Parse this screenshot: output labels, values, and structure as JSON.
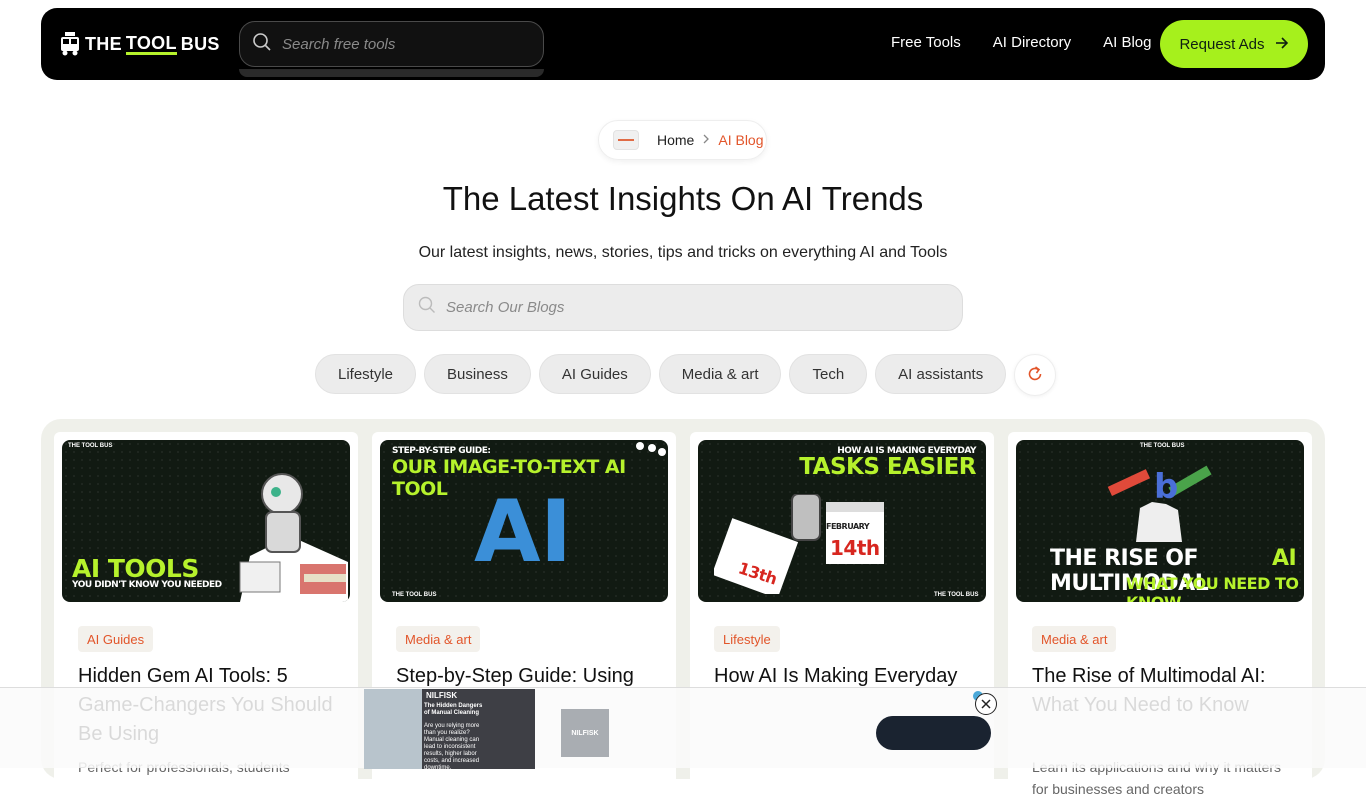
{
  "nav": {
    "logo_text_1": "THE",
    "logo_text_2": "TOOL",
    "logo_text_3": "BUS",
    "search_placeholder": "Search free tools",
    "links": [
      "Free Tools",
      "AI Directory",
      "AI Blog"
    ],
    "cta": "Request Ads"
  },
  "breadcrumb": {
    "home": "Home",
    "current": "AI Blog"
  },
  "hero": {
    "title": "The Latest Insights On AI Trends",
    "subtitle": "Our latest insights, news, stories, tips and tricks on everything AI and Tools",
    "search_placeholder": "Search Our Blogs"
  },
  "categories": [
    "Lifestyle",
    "Business",
    "AI Guides",
    "Media & art",
    "Tech",
    "AI assistants"
  ],
  "cards": [
    {
      "tag": "AI Guides",
      "title": "Hidden Gem AI Tools: 5 Game-Changers You Should Be Using",
      "desc": "Perfect for professionals, students",
      "img_line1": "AI TOOLS",
      "img_line2": "YOU DIDN'T KNOW YOU NEEDED"
    },
    {
      "tag": "Media & art",
      "title": "Step-by-Step Guide: Using",
      "desc": "",
      "img_line1": "STEP-BY-STEP GUIDE:",
      "img_line2": "OUR IMAGE-TO-TEXT AI TOOL",
      "img_line3": "AI"
    },
    {
      "tag": "Lifestyle",
      "title": "How AI Is Making Everyday",
      "desc": "",
      "img_line1": "HOW AI IS MAKING EVERYDAY",
      "img_line2": "TASKS EASIER",
      "img_line3": "FEBRUARY",
      "img_line4": "14th",
      "img_line5": "13th"
    },
    {
      "tag": "Media & art",
      "title": "The Rise of Multimodal AI: What You Need to Know",
      "desc": "Learn its applications and why it matters for businesses and creators",
      "img_line1": "THE RISE OF MULTIMODAL",
      "img_line1b": "AI",
      "img_line2": "WHAT YOU NEED TO KNOW"
    }
  ],
  "img_brand": "THE TOOL BUS",
  "ad": {
    "brand": "NILFISK",
    "headline": "The Hidden Dangers of Manual Cleaning",
    "body": "Are you relying more than you realize? Manual cleaning can lead to inconsistent results, higher labor costs, and increased downtime."
  },
  "colors": {
    "accent_green": "#a6f01c",
    "accent_orange": "#e2552a",
    "nav_bg": "#000000"
  }
}
